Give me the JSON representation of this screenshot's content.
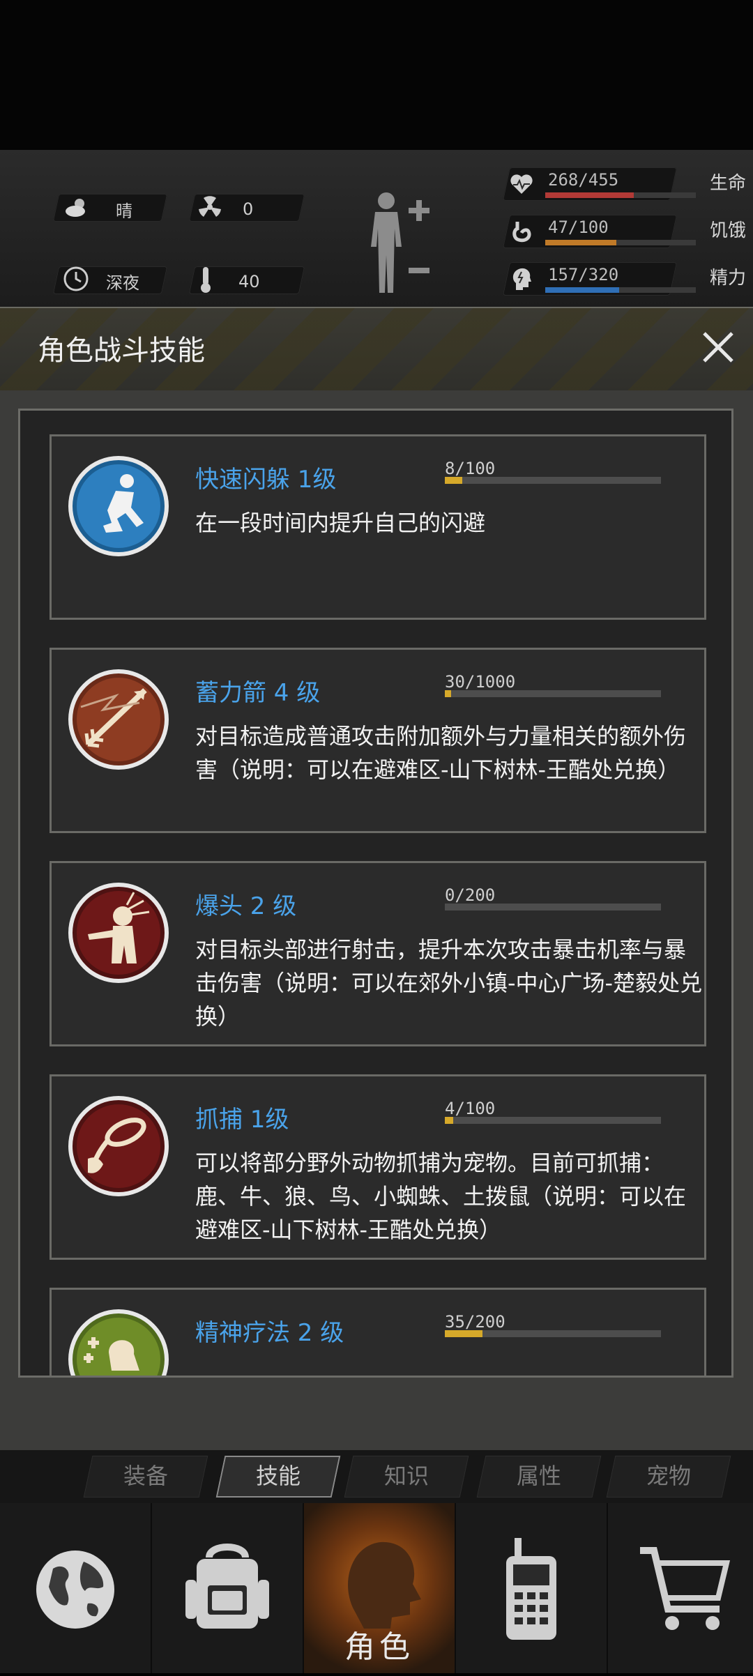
{
  "weather": {
    "condition": "晴",
    "radiation": "0",
    "time_of_day": "深夜",
    "temperature": "40"
  },
  "vitals": [
    {
      "icon": "heart-icon",
      "value": "268/455",
      "label": "生命",
      "fraction": 0.589,
      "color": "#b23a36"
    },
    {
      "icon": "stomach-icon",
      "value": "47/100",
      "label": "饥饿",
      "fraction": 0.47,
      "color": "#c07a28"
    },
    {
      "icon": "brain-icon",
      "value": "157/320",
      "label": "精力",
      "fraction": 0.49,
      "color": "#2f6fb6"
    }
  ],
  "panel": {
    "title": "角色战斗技能"
  },
  "skills": [
    {
      "name": "快速闪躲 1级",
      "progress": "8/100",
      "fraction": 0.08,
      "desc": "在一段时间内提升自己的闪避",
      "icon": "dodge-icon"
    },
    {
      "name": "蓄力箭 4 级",
      "progress": "30/1000",
      "fraction": 0.03,
      "desc": "对目标造成普通攻击附加额外与力量相关的额外伤害（说明：可以在避难区-山下树林-王酷处兑换）",
      "icon": "arrow-icon"
    },
    {
      "name": "爆头 2 级",
      "progress": "0/200",
      "fraction": 0.0,
      "desc": "对目标头部进行射击，提升本次攻击暴击机率与暴击伤害（说明：可以在郊外小镇-中心广场-楚毅处兑换）",
      "icon": "headshot-icon"
    },
    {
      "name": "抓捕 1级",
      "progress": "4/100",
      "fraction": 0.04,
      "desc": "可以将部分野外动物抓捕为宠物。目前可抓捕：鹿、牛、狼、鸟、小蜘蛛、土拨鼠（说明：可以在避难区-山下树林-王酷处兑换）",
      "icon": "lasso-icon"
    },
    {
      "name": "精神疗法 2 级",
      "progress": "35/200",
      "fraction": 0.175,
      "desc": "",
      "icon": "heal-icon"
    }
  ],
  "tabs": [
    {
      "label": "装备",
      "active": false
    },
    {
      "label": "技能",
      "active": true
    },
    {
      "label": "知识",
      "active": false
    },
    {
      "label": "属性",
      "active": false
    },
    {
      "label": "宠物",
      "active": false
    }
  ],
  "nav": [
    {
      "icon": "globe-icon",
      "label": ""
    },
    {
      "icon": "backpack-icon",
      "label": ""
    },
    {
      "icon": "character-icon",
      "label": "角色"
    },
    {
      "icon": "radio-icon",
      "label": ""
    },
    {
      "icon": "cart-icon",
      "label": ""
    }
  ]
}
